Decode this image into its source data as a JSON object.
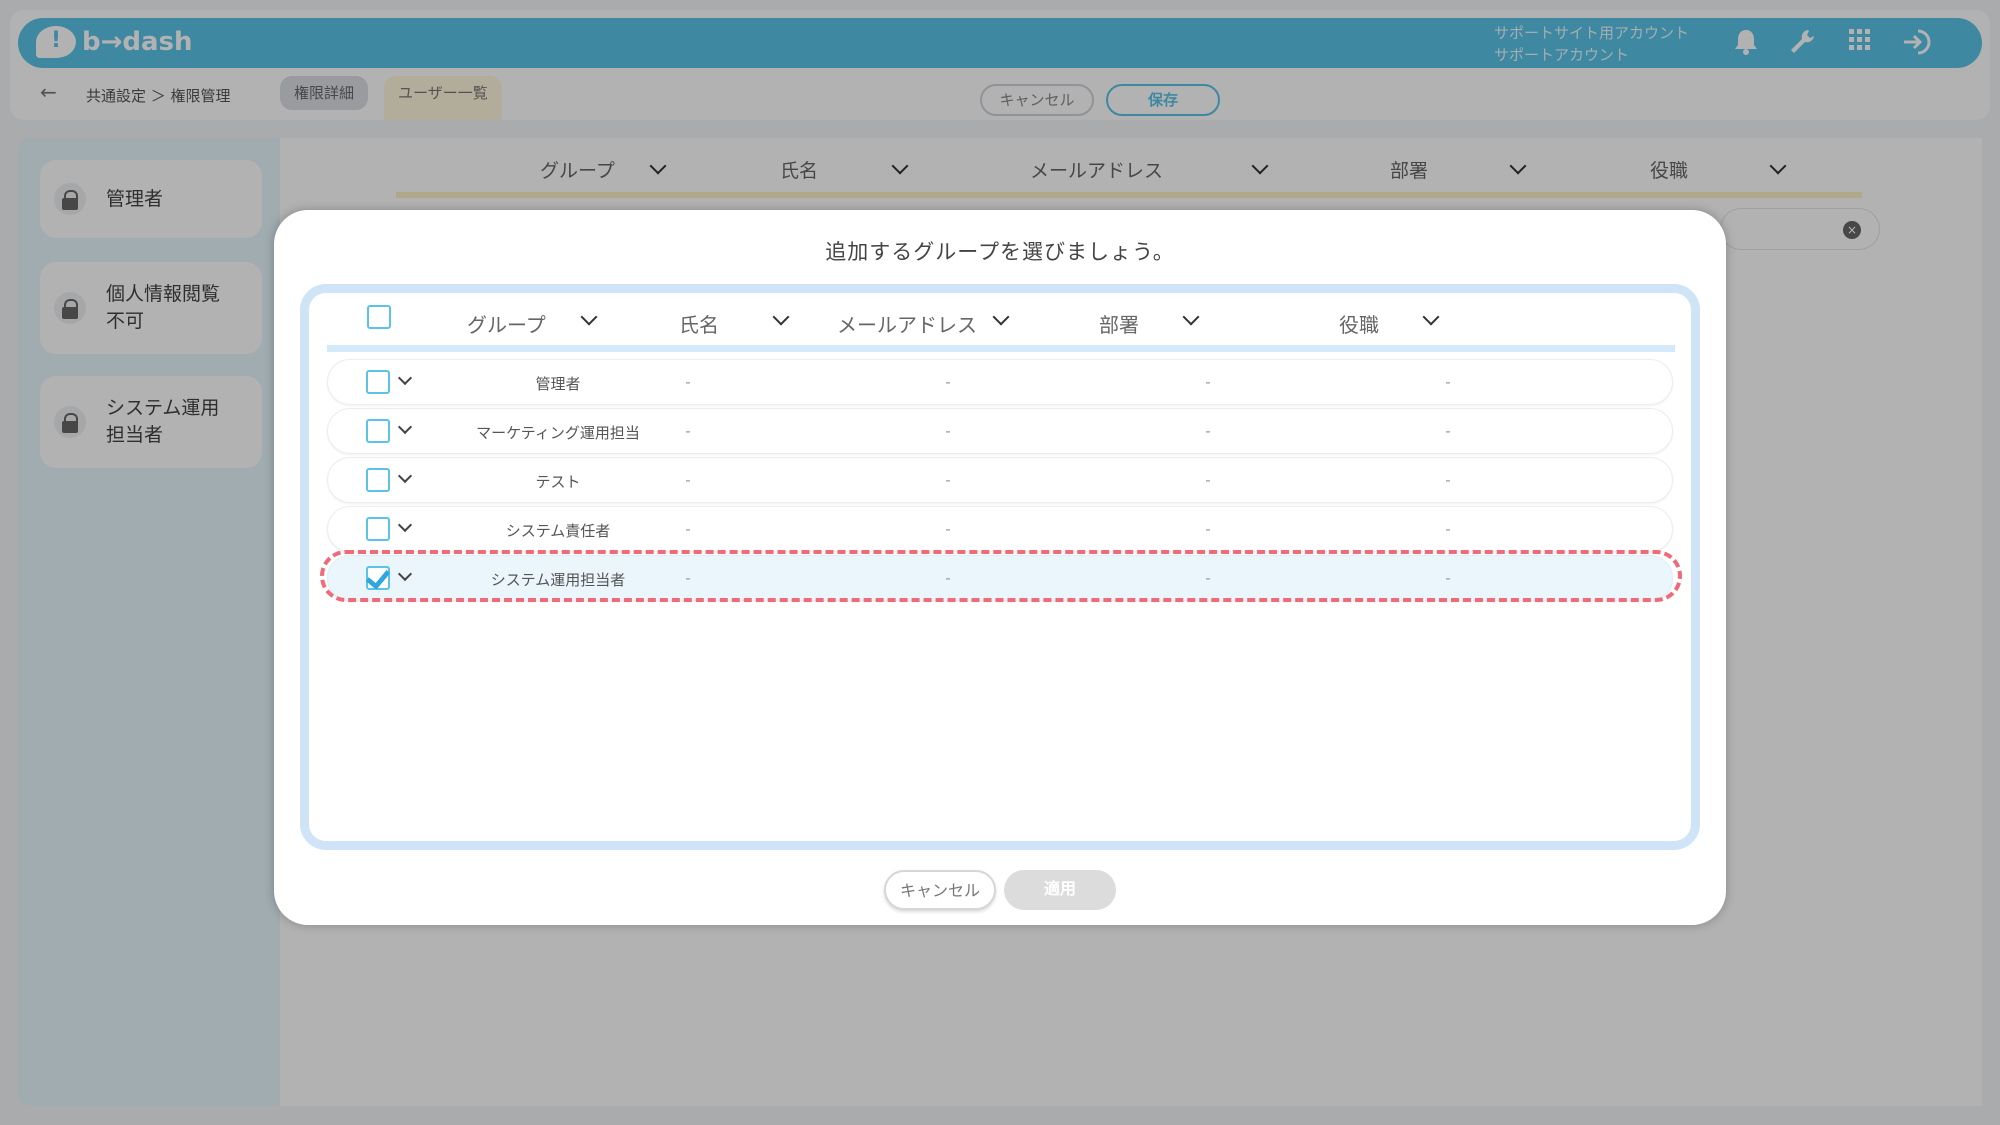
{
  "header": {
    "logo_text": "b→dash",
    "account_line1": "サポートサイト用アカウント",
    "account_line2": "サポートアカウント",
    "icons": [
      "bell-icon",
      "wrench-icon",
      "apps-grid-icon",
      "logout-icon"
    ]
  },
  "subheader": {
    "back_glyph": "←",
    "breadcrumb": "共通設定 ＞ 権限管理",
    "tab_detail": "権限詳細",
    "tab_users": "ユーザー一覧",
    "cancel_label": "キャンセル",
    "save_label": "保存"
  },
  "sidebar": {
    "items": [
      {
        "label": "管理者"
      },
      {
        "label": "個人情報閲覧\n不可"
      },
      {
        "label": "システム運用\n担当者"
      }
    ]
  },
  "background_table": {
    "columns": [
      "グループ",
      "氏名",
      "メールアドレス",
      "部署",
      "役職"
    ]
  },
  "modal": {
    "title": "追加するグループを選びましょう。",
    "columns": [
      "グループ",
      "氏名",
      "メールアドレス",
      "部署",
      "役職"
    ],
    "rows": [
      {
        "group": "管理者",
        "name": "-",
        "email": "-",
        "dept": "-",
        "title": "-",
        "checked": false
      },
      {
        "group": "マーケティング運用担当",
        "name": "-",
        "email": "-",
        "dept": "-",
        "title": "-",
        "checked": false
      },
      {
        "group": "テスト",
        "name": "-",
        "email": "-",
        "dept": "-",
        "title": "-",
        "checked": false
      },
      {
        "group": "システム責任者",
        "name": "-",
        "email": "-",
        "dept": "-",
        "title": "-",
        "checked": false
      },
      {
        "group": "システム運用担当者",
        "name": "-",
        "email": "-",
        "dept": "-",
        "title": "-",
        "checked": true
      }
    ],
    "cancel_label": "キャンセル",
    "apply_label": "適用"
  },
  "colors": {
    "brand": "#5bc3e9",
    "highlight": "#ef6b7a",
    "table_border": "#cfe4f6"
  }
}
